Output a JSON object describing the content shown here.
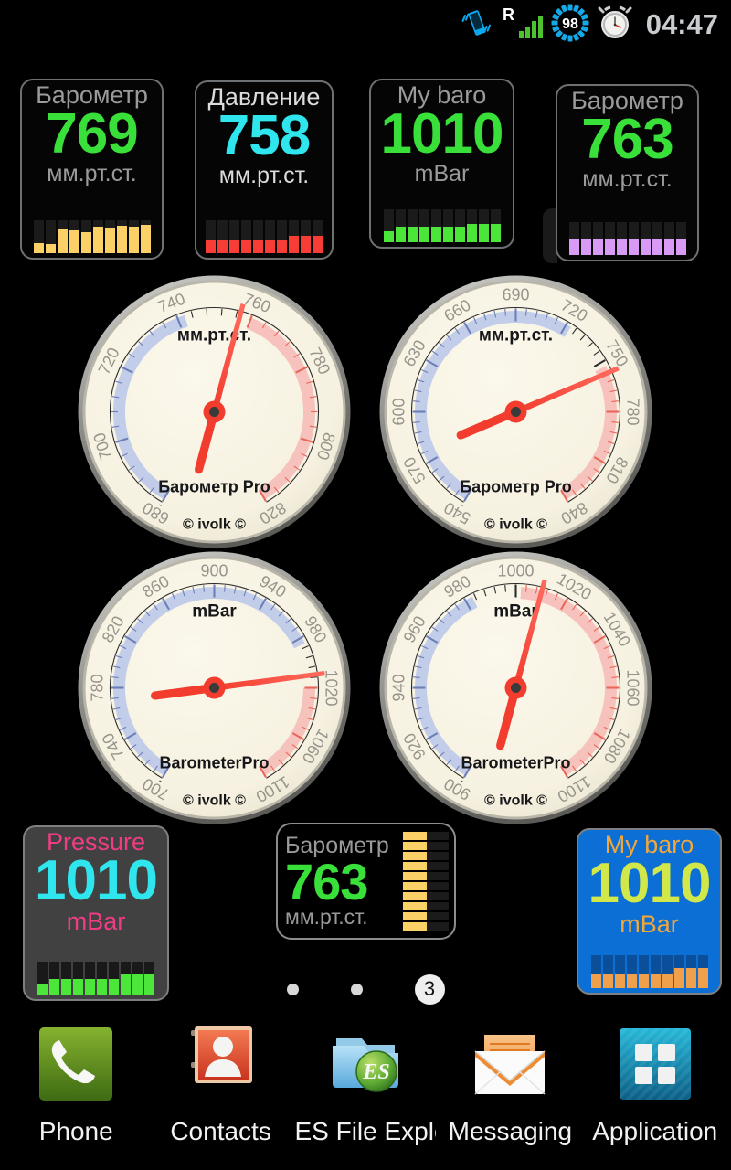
{
  "status_bar": {
    "clock": "04:47",
    "battery_level": "98",
    "roaming_label": "R",
    "icons": [
      "vibrate-phone-icon",
      "roaming-signal-icon",
      "battery-98-icon",
      "alarm-clock-icon"
    ]
  },
  "top_widgets": [
    {
      "name": "barometr-1",
      "title": "Барометр",
      "value": "769",
      "unit": "мм.рт.ст.",
      "value_color": "#3ae03a",
      "bar_color": "#fbd066",
      "bars": [
        30,
        28,
        72,
        70,
        65,
        80,
        78,
        82,
        80,
        85
      ]
    },
    {
      "name": "davlenie",
      "title": "Давление",
      "value": "758",
      "unit": "мм.рт.ст.",
      "value_color": "#2fe6ee",
      "bar_color": "#f83c36",
      "bars": [
        40,
        40,
        40,
        40,
        40,
        40,
        40,
        52,
        52,
        52
      ]
    },
    {
      "name": "mybaro-1",
      "title": "My baro",
      "value": "1010",
      "unit": "mBar",
      "value_color": "#3ae03a",
      "bar_color": "#4ce63a",
      "bars": [
        32,
        48,
        48,
        48,
        48,
        48,
        48,
        56,
        56,
        56
      ]
    },
    {
      "name": "barometr-2",
      "title": "Барометр",
      "value": "763",
      "unit": "мм.рт.ст.",
      "value_color": "#3ae03a",
      "bar_color": "#d89af5",
      "bars": [
        46,
        46,
        46,
        46,
        46,
        46,
        46,
        46,
        46,
        46
      ]
    }
  ],
  "gauges": [
    {
      "name": "gauge-mmhg-wide",
      "unit_label": "мм.рт.ст.",
      "brand": "Барометр Pro",
      "copyright": "© ivolk ©",
      "ticks": [
        "680",
        "700",
        "720",
        "740",
        "760",
        "780",
        "800",
        "820"
      ],
      "min": 680,
      "max": 820,
      "value": 757,
      "blue_from": 680,
      "blue_to": 742,
      "red_from": 760,
      "red_to": 820
    },
    {
      "name": "gauge-mmhg-full",
      "unit_label": "мм.рт.ст.",
      "brand": "Барометр Pro",
      "copyright": "© ivolk ©",
      "ticks": [
        "540",
        "570",
        "600",
        "630",
        "660",
        "690",
        "720",
        "750",
        "780",
        "810",
        "840"
      ],
      "min": 540,
      "max": 840,
      "value": 757,
      "blue_from": 540,
      "blue_to": 723,
      "red_from": 753,
      "red_to": 840
    },
    {
      "name": "gauge-mbar-wide",
      "unit_label": "mBar",
      "brand": "BarometerPro",
      "copyright": "© ivolk ©",
      "ticks": [
        "700",
        "740",
        "780",
        "820",
        "860",
        "900",
        "940",
        "980",
        "1020",
        "1060",
        "1100"
      ],
      "min": 700,
      "max": 1100,
      "value": 1010,
      "blue_from": 700,
      "blue_to": 985,
      "red_from": 1020,
      "red_to": 1100
    },
    {
      "name": "gauge-mbar-narrow",
      "unit_label": "mBar",
      "brand": "BarometerPro",
      "copyright": "© ivolk ©",
      "ticks": [
        "900",
        "920",
        "940",
        "960",
        "980",
        "1000",
        "1020",
        "1040",
        "1060",
        "1080",
        "1100"
      ],
      "min": 900,
      "max": 1100,
      "value": 1010,
      "blue_from": 900,
      "blue_to": 983,
      "red_from": 1002,
      "red_to": 1100
    }
  ],
  "bottom_widgets": {
    "pressure": {
      "title": "Pressure",
      "value": "1010",
      "unit": "mBar",
      "title_color": "#ef3d85",
      "value_color": "#2fe6ee",
      "bar_color": "#4ce63a",
      "bars": [
        30,
        48,
        48,
        48,
        48,
        48,
        48,
        62,
        62,
        62
      ]
    },
    "barometr_3": {
      "title": "Барометр",
      "value": "763",
      "unit": "мм.рт.ст.",
      "value_color": "#3ae03a",
      "bar_color": "#fbd066",
      "bars": [
        52,
        52,
        52,
        52,
        52,
        52,
        52,
        52,
        52,
        52
      ]
    },
    "mybaro_2": {
      "title": "My baro",
      "value": "1010",
      "unit": "mBar",
      "title_color": "#f2a73b",
      "value_color": "#d2e84a",
      "bar_color": "#f0a04b",
      "bars": [
        42,
        42,
        42,
        42,
        42,
        42,
        42,
        60,
        60,
        60
      ]
    }
  },
  "page_indicator": {
    "dots": [
      "",
      ""
    ],
    "current_label": "3"
  },
  "dock": [
    {
      "label": "Phone",
      "icon": "phone-handset-icon"
    },
    {
      "label": "Contacts",
      "icon": "contacts-book-icon"
    },
    {
      "label": "ES File Explo",
      "icon": "es-file-explorer-icon"
    },
    {
      "label": "Messaging",
      "icon": "envelope-icon"
    },
    {
      "label": "Application",
      "icon": "app-drawer-grid-icon"
    }
  ]
}
